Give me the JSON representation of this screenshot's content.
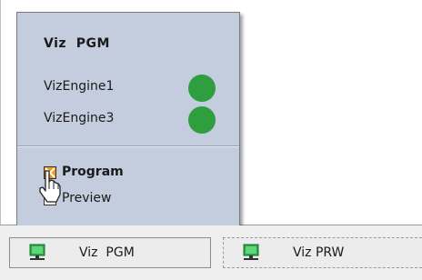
{
  "popup": {
    "title": "Viz  PGM",
    "engines": [
      {
        "name": "VizEngine1",
        "status": "online",
        "status_color": "#2e9e3e"
      },
      {
        "name": "VizEngine3",
        "status": "online",
        "status_color": "#2e9e3e"
      }
    ],
    "options": [
      {
        "label": "Program",
        "checked": true
      },
      {
        "label": "Preview",
        "checked": false
      }
    ]
  },
  "taskbar": {
    "buttons": [
      {
        "label": "Viz  PGM",
        "icon": "monitor-icon",
        "active": true
      },
      {
        "label": "Viz PRW",
        "icon": "monitor-icon",
        "active": false
      }
    ]
  },
  "colors": {
    "popup_bg": "#c4cddd",
    "status_green": "#2e9e3e",
    "checked_orange": "#f29a1e",
    "icon_green": "#2aa84a"
  }
}
